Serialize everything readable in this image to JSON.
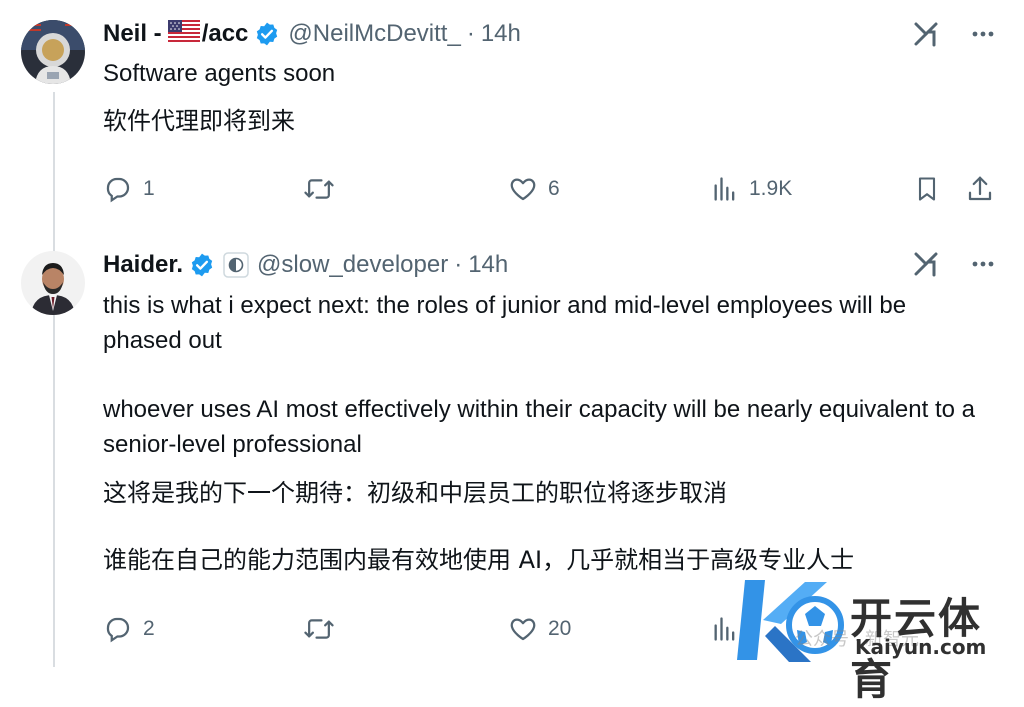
{
  "tweet1": {
    "display_name": "Neil -",
    "name_suffix": "/acc",
    "handle": "@NeilMcDevitt_",
    "time": "14h",
    "text_en": "Software agents soon",
    "text_cn": "软件代理即将到来",
    "reply_count": "1",
    "retweet_count": "",
    "like_count": "6",
    "view_count": "1.9K"
  },
  "tweet2": {
    "display_name": "Haider.",
    "handle": "@slow_developer",
    "time": "14h",
    "text_en_p1": "this is what i expect next: the roles of junior and mid-level employees will be phased out",
    "text_en_p2": "whoever uses AI most effectively within their capacity will be nearly equivalent to a senior-level professional",
    "text_cn_p1": "这将是我的下一个期待：初级和中层员工的职位将逐步取消",
    "text_cn_p2": "谁能在自己的能力范围内最有效地使用 AI，几乎就相当于高级专业人士",
    "reply_count": "2",
    "retweet_count": "",
    "like_count": "20"
  },
  "watermark": {
    "brand_cn": "开云体育",
    "brand_en": "Kaiyun.com",
    "faint_text": "公众号 · 新智元"
  },
  "colors": {
    "text_primary": "#0f1419",
    "text_secondary": "#536471",
    "verified_blue": "#1d9bf0",
    "thread_line": "#d9dde1"
  },
  "icons": {
    "reply": "speech-bubble",
    "retweet": "repost-arrows",
    "like": "heart",
    "views": "bar-chart",
    "bookmark": "bookmark",
    "share": "upload-arrow",
    "grok": "grok-logo",
    "more": "three-dots"
  }
}
